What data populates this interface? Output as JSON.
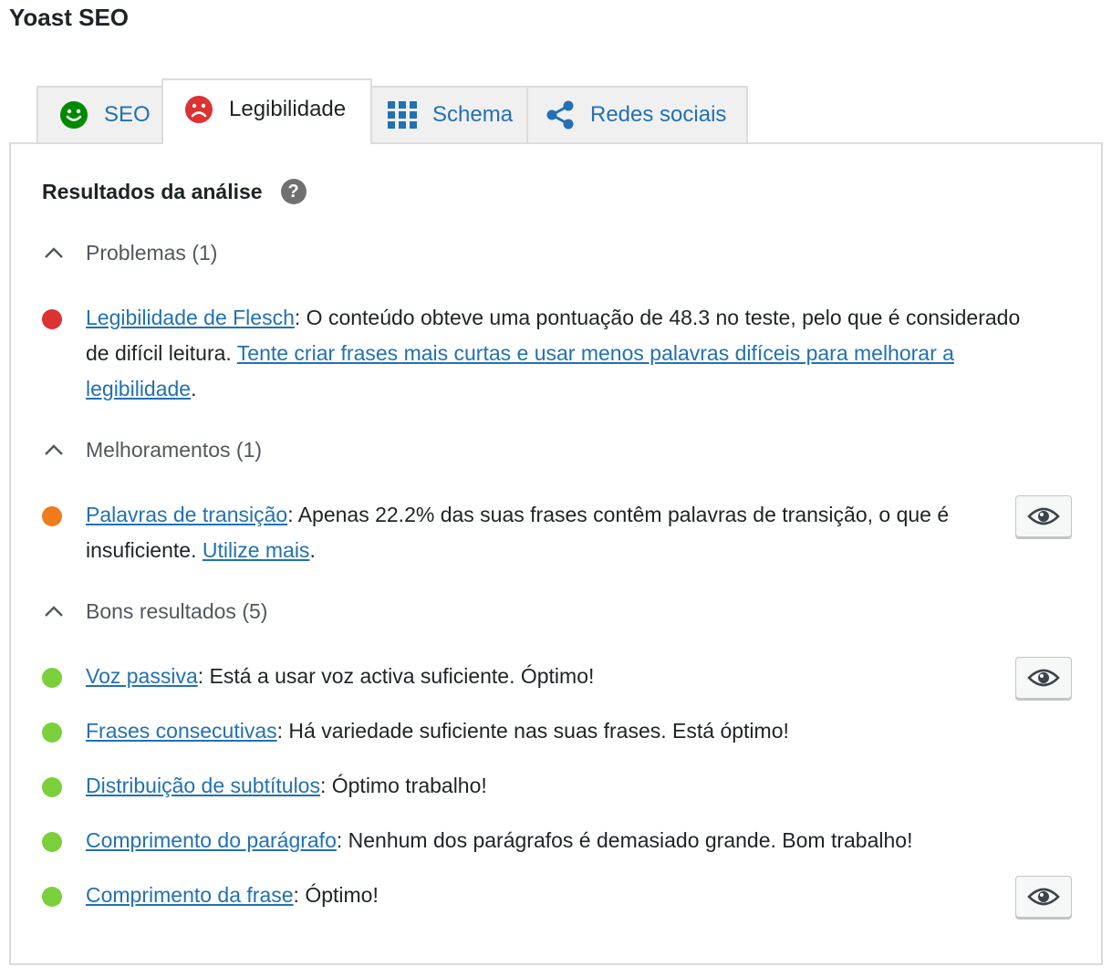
{
  "app_title": "Yoast SEO",
  "tabs": [
    {
      "label": "SEO",
      "icon": "smiley-happy-icon",
      "color": "#008a00",
      "active": false
    },
    {
      "label": "Legibilidade",
      "icon": "smiley-sad-icon",
      "color": "#dc3232",
      "active": true
    },
    {
      "label": "Schema",
      "icon": "grid-icon",
      "color": "#2271b1",
      "active": false
    },
    {
      "label": "Redes sociais",
      "icon": "share-icon",
      "color": "#2271b1",
      "active": false
    }
  ],
  "panel": {
    "title": "Resultados da análise",
    "help_symbol": "?"
  },
  "groups": {
    "problems": {
      "header": "Problemas (1)",
      "items": [
        {
          "color": "#dc3232",
          "link": "Legibilidade de Flesch",
          "text": ": O conteúdo obteve uma pontuação de 48.3 no teste, pelo que é considerado de difícil leitura. ",
          "link2": "Tente criar frases mais curtas e usar menos palavras difíceis para melhorar a legibilidade",
          "end": "."
        }
      ]
    },
    "improvements": {
      "header": "Melhoramentos (1)",
      "items": [
        {
          "color": "#ee7c1b",
          "link": "Palavras de transição",
          "text": ": Apenas 22.2% das suas frases contêm palavras de transição, o que é insuficiente. ",
          "link2": "Utilize mais",
          "end": "."
        }
      ]
    },
    "good": {
      "header": "Bons resultados (5)",
      "items": [
        {
          "color": "#7ad03a",
          "link": "Voz passiva",
          "text": ": Está a usar voz activa suficiente. Óptimo!"
        },
        {
          "color": "#7ad03a",
          "link": "Frases consecutivas",
          "text": ": Há variedade suficiente nas suas frases. Está óptimo!"
        },
        {
          "color": "#7ad03a",
          "link": "Distribuição de subtítulos",
          "text": ": Óptimo trabalho!"
        },
        {
          "color": "#7ad03a",
          "link": "Comprimento do parágrafo",
          "text": ": Nenhum dos parágrafos é demasiado grande. Bom trabalho!"
        },
        {
          "color": "#7ad03a",
          "link": "Comprimento da frase",
          "text": ": Óptimo!"
        }
      ]
    }
  },
  "colors": {
    "link": "#2271b1",
    "problem": "#dc3232",
    "improvement": "#ee7c1b",
    "good": "#7ad03a"
  }
}
